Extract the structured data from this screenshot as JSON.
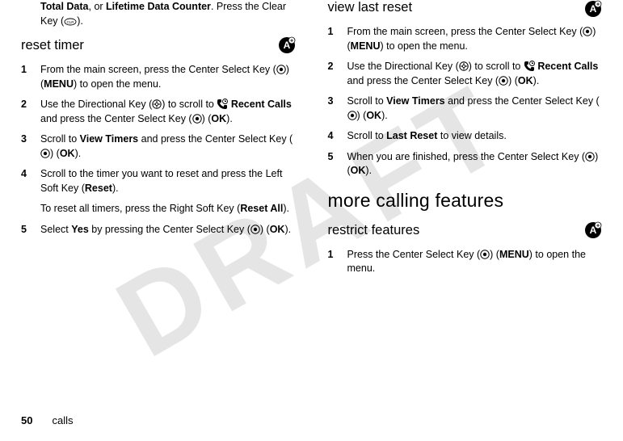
{
  "watermark": "DRAFT",
  "left": {
    "intro_prefix": "Total Data",
    "intro_mid": ", or ",
    "intro_b2": "Lifetime Data Counter",
    "intro_suffix": ". Press the Clear Key (",
    "intro_end": ").",
    "section_heading": "reset timer",
    "steps": {
      "s1": "From the main screen, press the Center Select Key (",
      "s1_menu": "MENU",
      "s1_end": ") to open the menu.",
      "s2a": "Use the Directional Key (",
      "s2b": ") to scroll to ",
      "s2_rc": "Recent Calls",
      "s2c": " and press the Center Select Key (",
      "s2_ok": "OK",
      "s2_end": ").",
      "s3a": "Scroll to ",
      "s3_vt": "View Timers",
      "s3b": " and press the Center Select Key (",
      "s3_ok": "OK",
      "s3_end": ").",
      "s4": "Scroll to the timer you want to reset and press the Left Soft Key (",
      "s4_reset": "Reset",
      "s4_end": ").",
      "s4p": "To reset all timers, press the Right Soft Key (",
      "s4p_b": "Reset All",
      "s4p_end": ").",
      "s5a": "Select ",
      "s5_yes": "Yes",
      "s5b": " by pressing the Center Select Key (",
      "s5_ok": "OK",
      "s5_end": ")."
    }
  },
  "right": {
    "section_heading": "view last reset",
    "steps": {
      "s1": "From the main screen, press the Center Select Key (",
      "s1_menu": "MENU",
      "s1_end": ") to open the menu.",
      "s2a": "Use the Directional Key (",
      "s2b": ") to scroll to ",
      "s2_rc": "Recent Calls",
      "s2c": " and press the Center Select Key (",
      "s2_ok": "OK",
      "s2_end": ").",
      "s3a": "Scroll to ",
      "s3_vt": "View Timers",
      "s3b": " and press the Center Select Key (",
      "s3_ok": "OK",
      "s3_end": ").",
      "s4a": "Scroll to ",
      "s4_lr": "Last Reset",
      "s4b": " to view details.",
      "s5a": "When you are finished, press the Center Select Key (",
      "s5_ok": "OK",
      "s5_end": ")."
    },
    "h1": "more calling features",
    "sub_heading": "restrict features",
    "rf_s1a": "Press the Center Select Key (",
    "rf_s1_menu": "MENU",
    "rf_s1b": ") to open the menu."
  },
  "footer": {
    "page_number": "50",
    "section": "calls"
  }
}
